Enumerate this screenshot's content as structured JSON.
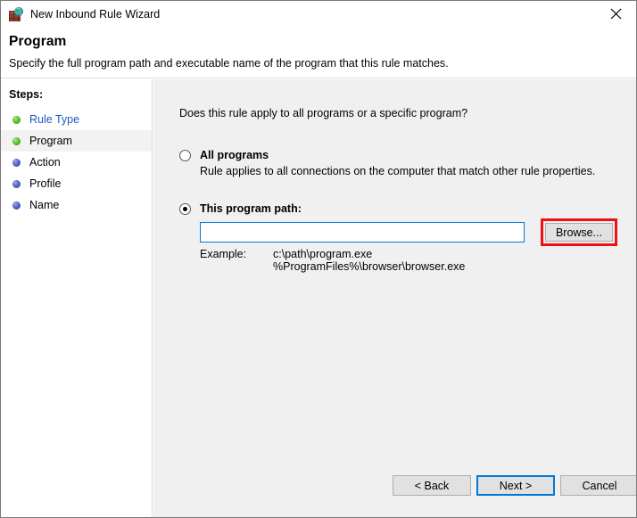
{
  "window": {
    "title": "New Inbound Rule Wizard",
    "icon": "firewall-globe-icon",
    "close_label": "✕"
  },
  "header": {
    "title": "Program",
    "subtitle": "Specify the full program path and executable name of the program that this rule matches."
  },
  "sidebar": {
    "heading": "Steps:",
    "items": [
      {
        "label": "Rule Type",
        "state": "done",
        "style": "link"
      },
      {
        "label": "Program",
        "state": "done",
        "style": "current"
      },
      {
        "label": "Action",
        "state": "todo",
        "style": "normal"
      },
      {
        "label": "Profile",
        "state": "todo",
        "style": "normal"
      },
      {
        "label": "Name",
        "state": "todo",
        "style": "normal"
      }
    ]
  },
  "main": {
    "question": "Does this rule apply to all programs or a specific program?",
    "options": [
      {
        "label": "All programs",
        "description": "Rule applies to all connections on the computer that match other rule properties.",
        "selected": false
      },
      {
        "label": "This program path:",
        "selected": true
      }
    ],
    "path_input": {
      "value": "",
      "placeholder": ""
    },
    "browse_label": "Browse...",
    "browse_highlight_color": "#EE1111",
    "example": {
      "label": "Example:",
      "line1": "c:\\path\\program.exe",
      "line2": "%ProgramFiles%\\browser\\browser.exe"
    }
  },
  "footer": {
    "back_label": "< Back",
    "next_label": "Next >",
    "cancel_label": "Cancel"
  },
  "colors": {
    "accent": "#0078D7",
    "panel_bg": "#F0F0F0",
    "sidebar_bg": "#FFFFFF",
    "link": "#1A56C4",
    "highlight": "#EE1111"
  }
}
